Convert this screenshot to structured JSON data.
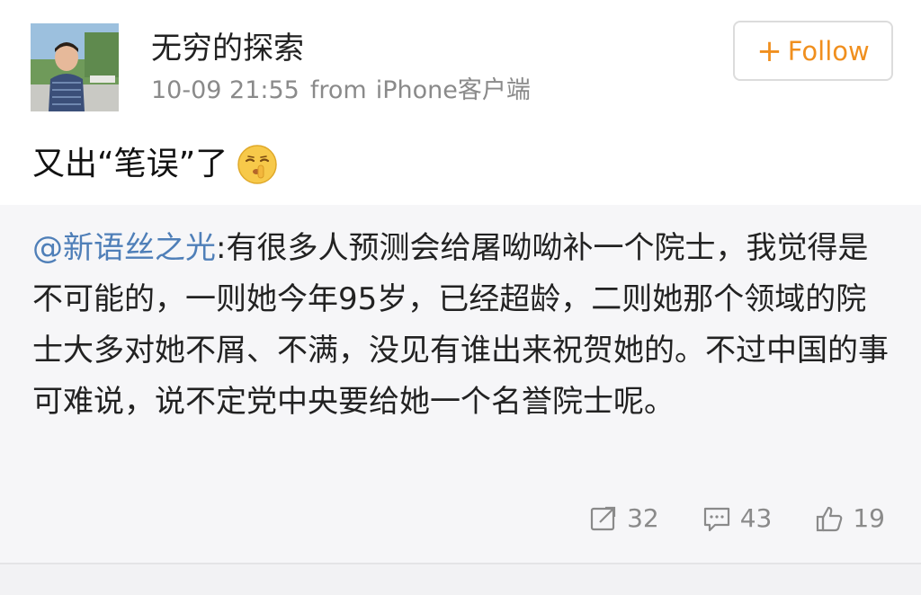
{
  "author": {
    "name": "无穷的探索",
    "avatar_icon": "child-portrait-avatar"
  },
  "meta": {
    "timestamp": "10-09 21:55",
    "from_label": "from",
    "source": "iPhone客户端"
  },
  "follow": {
    "plus": "+",
    "label": "Follow",
    "color": "#f08f1e"
  },
  "post": {
    "text": "又出“笔误”了",
    "emoji_icon": "shush-face-emoji"
  },
  "retweet": {
    "mention": "@新语丝之光",
    "text": ":有很多人预测会给屠呦呦补一个院士，我觉得是不可能的，一则她今年95岁，已经超龄，二则她那个领域的院士大多对她不屑、不满，没见有谁出来祝贺她的。不过中国的事可难说，说不定党中央要给她一个名誉院士呢。",
    "mention_color": "#4f7fb8"
  },
  "actions": {
    "repost": {
      "icon": "repost-icon",
      "count": "32"
    },
    "comment": {
      "icon": "comment-icon",
      "count": "43"
    },
    "like": {
      "icon": "thumbs-up-icon",
      "count": "19"
    }
  }
}
